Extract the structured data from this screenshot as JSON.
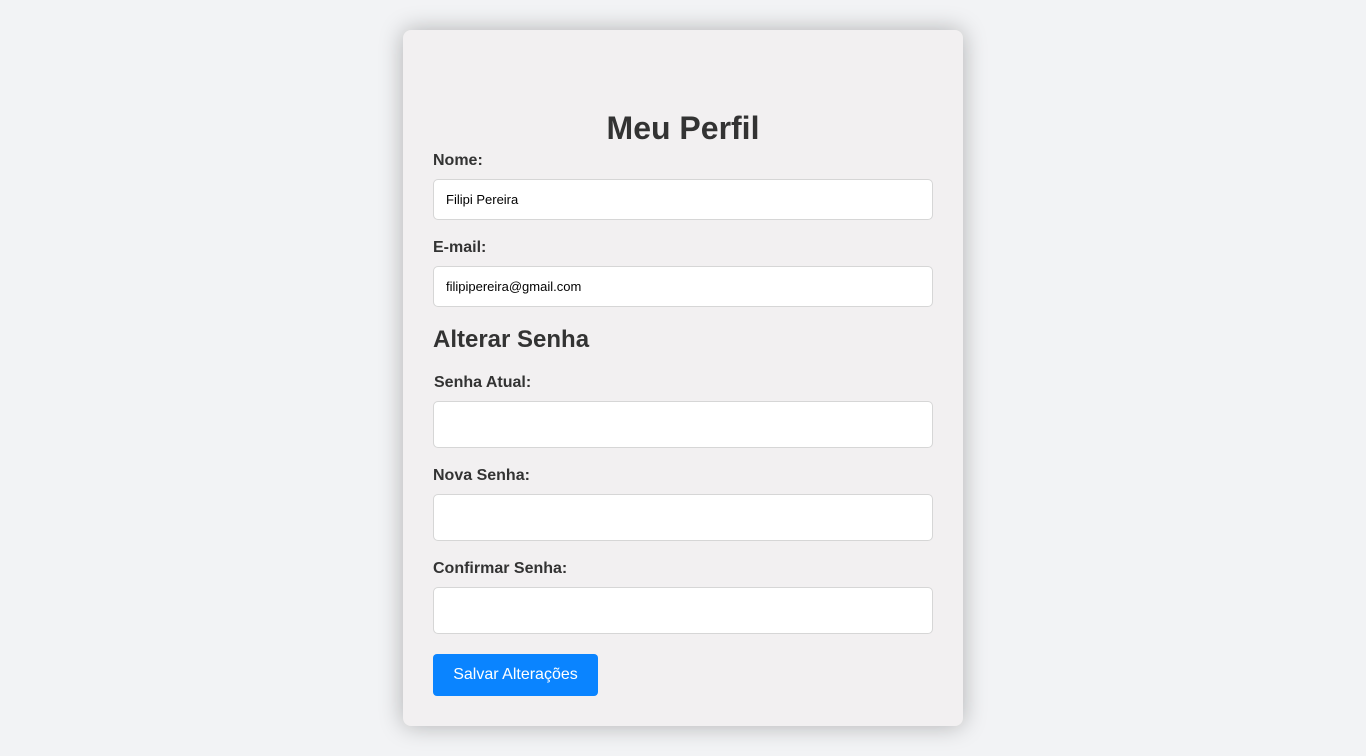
{
  "profile": {
    "title": "Meu Perfil",
    "name_label": "Nome:",
    "name_value": "Filipi Pereira",
    "email_label": "E-mail:",
    "email_value": "filipipereira@gmail.com"
  },
  "password": {
    "section_title": "Alterar Senha",
    "current_label": "Senha Atual:",
    "current_value": "",
    "new_label": "Nova Senha:",
    "new_value": "",
    "confirm_label": "Confirmar Senha:",
    "confirm_value": ""
  },
  "actions": {
    "save_label": "Salvar Alterações"
  },
  "colors": {
    "accent": "#0a84ff",
    "page_background": "#f2f3f5",
    "card_background": "#f2f0f1",
    "text": "#333333"
  }
}
